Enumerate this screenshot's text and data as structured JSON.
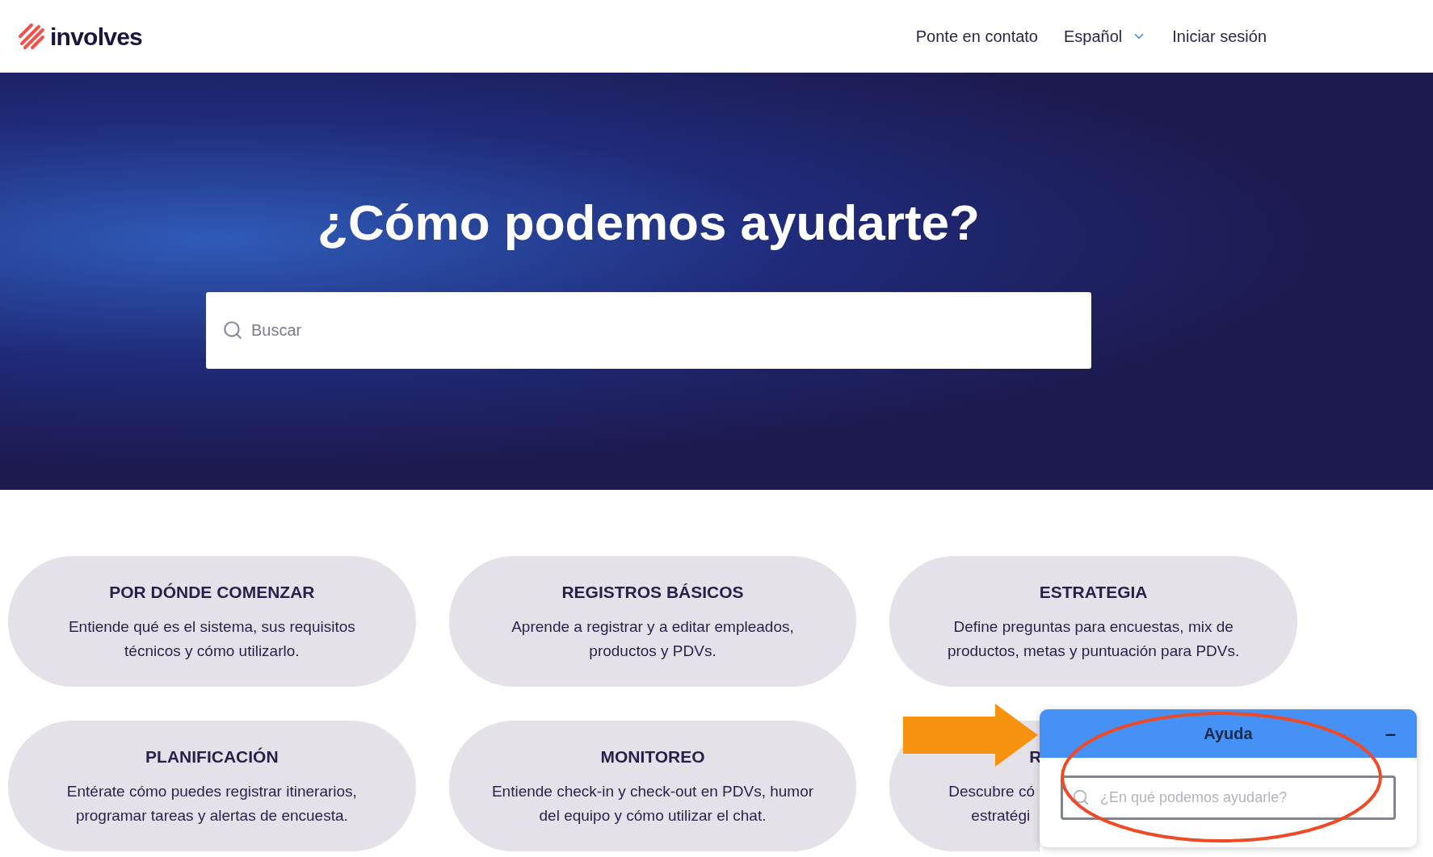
{
  "header": {
    "logo": "involves",
    "nav": [
      {
        "kind": "link",
        "label": "Ponte en contato"
      },
      {
        "kind": "dropdown",
        "label": "Español"
      },
      {
        "kind": "link",
        "label": "Iniciar sesión"
      }
    ]
  },
  "hero": {
    "title": "¿Cómo podemos ayudarte?",
    "search": {
      "placeholder": "Buscar"
    }
  },
  "cards": [
    {
      "kind": "full",
      "title": "POR DÓNDE COMENZAR",
      "description": "Entiende qué es el sistema, sus requisitos técnicos y cómo utilizarlo."
    },
    {
      "kind": "full",
      "title": "REGISTROS BÁSICOS",
      "description": "Aprende a registrar y a editar empleados, productos y PDVs."
    },
    {
      "kind": "full",
      "title": "ESTRATEGIA",
      "description": "Define preguntas para encuestas, mix de productos, metas y puntuación para PDVs."
    },
    {
      "kind": "full",
      "title": "PLANIFICACIÓN",
      "description": "Entérate cómo puedes registrar itinerarios, programar tareas y alertas de encuesta."
    },
    {
      "kind": "full",
      "title": "MONITOREO",
      "description": "Entiende check-in y check-out en PDVs, humor del equipo y cómo utilizar el chat."
    },
    {
      "kind": "partial",
      "title": "R",
      "lines": [
        "Descubre có",
        "estratégi"
      ]
    }
  ],
  "help_widget": {
    "title": "Ayuda",
    "minimize": "–",
    "search": {
      "placeholder": "¿En qué podemos ayudarle?"
    }
  }
}
